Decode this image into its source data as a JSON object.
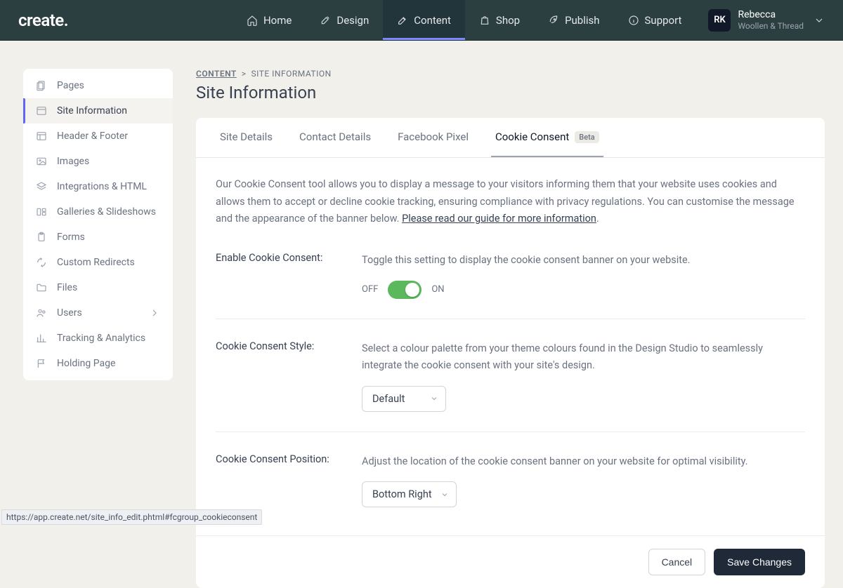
{
  "header": {
    "logo": "create",
    "nav": [
      {
        "label": "Home",
        "icon": "home"
      },
      {
        "label": "Design",
        "icon": "brush"
      },
      {
        "label": "Content",
        "icon": "edit",
        "active": true
      },
      {
        "label": "Shop",
        "icon": "bag"
      },
      {
        "label": "Publish",
        "icon": "rocket"
      },
      {
        "label": "Support",
        "icon": "info"
      }
    ],
    "user": {
      "initials": "RK",
      "name": "Rebecca",
      "sub": "Woollen & Thread"
    }
  },
  "breadcrumb": {
    "root": "CONTENT",
    "sep": ">",
    "current": "SITE INFORMATION"
  },
  "page_title": "Site Information",
  "sidebar": {
    "items": [
      {
        "label": "Pages",
        "icon": "pages"
      },
      {
        "label": "Site Information",
        "icon": "browser",
        "active": true
      },
      {
        "label": "Header & Footer",
        "icon": "layout"
      },
      {
        "label": "Images",
        "icon": "image"
      },
      {
        "label": "Integrations & HTML",
        "icon": "stack"
      },
      {
        "label": "Galleries & Slideshows",
        "icon": "gallery"
      },
      {
        "label": "Forms",
        "icon": "clipboard"
      },
      {
        "label": "Custom Redirects",
        "icon": "redirect"
      },
      {
        "label": "Files",
        "icon": "folder"
      },
      {
        "label": "Users",
        "icon": "users",
        "chevron": true
      },
      {
        "label": "Tracking & Analytics",
        "icon": "chart"
      },
      {
        "label": "Holding Page",
        "icon": "flag"
      }
    ]
  },
  "tabs": [
    {
      "label": "Site Details"
    },
    {
      "label": "Contact Details"
    },
    {
      "label": "Facebook Pixel"
    },
    {
      "label": "Cookie Consent",
      "badge": "Beta",
      "active": true
    }
  ],
  "intro": {
    "text": "Our Cookie Consent tool allows you to display a message to your visitors informing them that your website uses cookies and allows them to accept or decline cookie tracking, ensuring compliance with privacy regulations. You can customise the message and the appearance of the banner below. ",
    "link": "Please read our guide for more information",
    "suffix": "."
  },
  "fields": {
    "enable": {
      "label": "Enable Cookie Consent:",
      "desc": "Toggle this setting to display the cookie consent banner on your website.",
      "off": "OFF",
      "on": "ON"
    },
    "style": {
      "label": "Cookie Consent Style:",
      "desc": "Select a colour palette from your theme colours found in the Design Studio to seamlessly integrate the cookie consent with your site's design.",
      "value": "Default"
    },
    "position": {
      "label": "Cookie Consent Position:",
      "desc": "Adjust the location of the cookie consent banner on your website for optimal visibility.",
      "value": "Bottom Right"
    }
  },
  "footer": {
    "cancel": "Cancel",
    "save": "Save Changes"
  },
  "status_url": "https://app.create.net/site_info_edit.phtml#fcgroup_cookieconsent"
}
